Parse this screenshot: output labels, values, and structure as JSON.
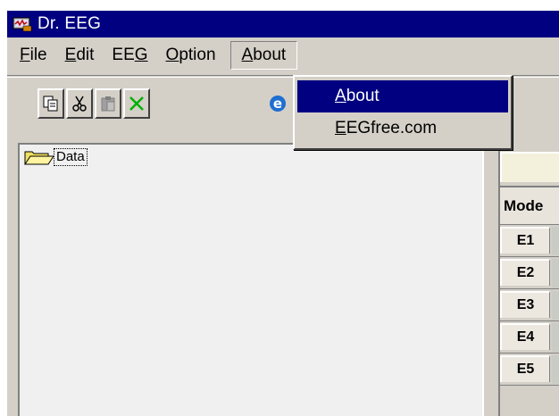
{
  "window": {
    "title": "Dr. EEG",
    "title_color": "#000080"
  },
  "menubar": {
    "items": [
      {
        "pre": "",
        "key": "F",
        "post": "ile"
      },
      {
        "pre": "",
        "key": "E",
        "post": "dit"
      },
      {
        "pre": "EE",
        "key": "G",
        "post": ""
      },
      {
        "pre": "",
        "key": "O",
        "post": "ption"
      },
      {
        "pre": "",
        "key": "A",
        "post": "bout"
      }
    ]
  },
  "dropdown": {
    "items": [
      {
        "pre": "",
        "key": "A",
        "post": "bout",
        "selected": true
      },
      {
        "pre": "",
        "key": "E",
        "post": "EGfree.com",
        "selected": false
      }
    ]
  },
  "toolbar": {
    "icons": [
      "copy-icon",
      "cut-icon",
      "paste-icon",
      "delete-icon",
      "internet-explorer-icon"
    ]
  },
  "tree": {
    "root_label": "Data",
    "root_icon": "folder-open-icon"
  },
  "grid": {
    "header": "Mode",
    "rows": [
      "E1",
      "E2",
      "E3",
      "E4",
      "E5"
    ]
  },
  "colors": {
    "selection": "#000080",
    "face": "#d4d0c8",
    "folder": "#f0e060"
  }
}
